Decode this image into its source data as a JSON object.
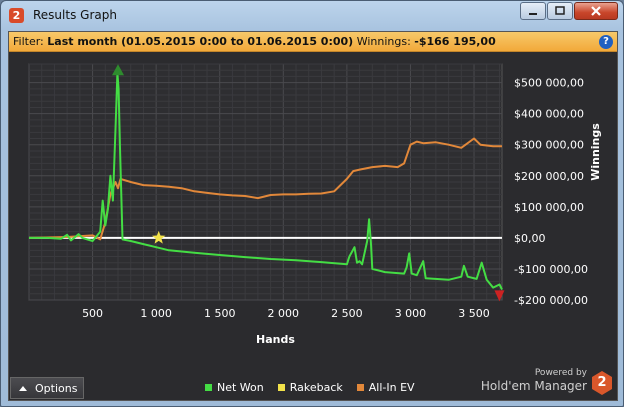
{
  "window": {
    "title": "Results Graph",
    "badge": "2"
  },
  "filter": {
    "label": "Filter:",
    "value": "Last month (01.05.2015 0:00 to 01.06.2015 0:00)",
    "winnings_label": "Winnings:",
    "winnings_value": "-$166 195,00"
  },
  "options": {
    "label": "Options",
    "icon": "caret-up-icon"
  },
  "legend": [
    {
      "label": "Net Won",
      "color": "#44dd44"
    },
    {
      "label": "Rakeback",
      "color": "#f2e24a"
    },
    {
      "label": "All-In EV",
      "color": "#e2883a"
    }
  ],
  "branding": {
    "powered_by": "Powered by",
    "product": "Hold'em Manager",
    "logo_text": "2"
  },
  "chart_data": {
    "type": "line",
    "xlabel": "Hands",
    "ylabel": "Winnings",
    "xlim": [
      0,
      3720
    ],
    "ylim": [
      -200000,
      560000
    ],
    "x_ticks": [
      {
        "v": 500,
        "label": "500"
      },
      {
        "v": 1000,
        "label": "1 000"
      },
      {
        "v": 1500,
        "label": "1 500"
      },
      {
        "v": 2000,
        "label": "2 000"
      },
      {
        "v": 2500,
        "label": "2 500"
      },
      {
        "v": 3000,
        "label": "3 000"
      },
      {
        "v": 3500,
        "label": "3 500"
      }
    ],
    "y_ticks": [
      {
        "v": 500000,
        "label": "$500 000,00"
      },
      {
        "v": 400000,
        "label": "$400 000,00"
      },
      {
        "v": 300000,
        "label": "$300 000,00"
      },
      {
        "v": 200000,
        "label": "$200 000,00"
      },
      {
        "v": 100000,
        "label": "$100 000,00"
      },
      {
        "v": 0,
        "label": "$0,00"
      },
      {
        "v": -100000,
        "label": "-$100 000,00"
      },
      {
        "v": -200000,
        "label": "-$200 000,00"
      }
    ],
    "series": [
      {
        "name": "Net Won",
        "color": "#44dd44",
        "points": [
          [
            0,
            0
          ],
          [
            150,
            0
          ],
          [
            250,
            -3000
          ],
          [
            300,
            10000
          ],
          [
            330,
            -8000
          ],
          [
            390,
            12000
          ],
          [
            420,
            0
          ],
          [
            500,
            -10000
          ],
          [
            560,
            20000
          ],
          [
            580,
            120000
          ],
          [
            600,
            40000
          ],
          [
            620,
            90000
          ],
          [
            640,
            200000
          ],
          [
            660,
            120000
          ],
          [
            680,
            350000
          ],
          [
            695,
            530000
          ],
          [
            705,
            480000
          ],
          [
            715,
            300000
          ],
          [
            725,
            150000
          ],
          [
            735,
            -5000
          ],
          [
            800,
            -10000
          ],
          [
            900,
            -20000
          ],
          [
            1000,
            -30000
          ],
          [
            1100,
            -40000
          ],
          [
            1300,
            -48000
          ],
          [
            1500,
            -55000
          ],
          [
            1700,
            -62000
          ],
          [
            1900,
            -68000
          ],
          [
            2100,
            -72000
          ],
          [
            2300,
            -78000
          ],
          [
            2500,
            -85000
          ],
          [
            2520,
            -60000
          ],
          [
            2560,
            -30000
          ],
          [
            2580,
            -80000
          ],
          [
            2600,
            -75000
          ],
          [
            2620,
            -85000
          ],
          [
            2660,
            -10000
          ],
          [
            2675,
            60000
          ],
          [
            2690,
            -20000
          ],
          [
            2700,
            -100000
          ],
          [
            2800,
            -110000
          ],
          [
            2950,
            -115000
          ],
          [
            2970,
            -95000
          ],
          [
            2990,
            -50000
          ],
          [
            3010,
            -115000
          ],
          [
            3050,
            -120000
          ],
          [
            3100,
            -75000
          ],
          [
            3120,
            -130000
          ],
          [
            3300,
            -135000
          ],
          [
            3400,
            -125000
          ],
          [
            3420,
            -90000
          ],
          [
            3450,
            -125000
          ],
          [
            3520,
            -132000
          ],
          [
            3560,
            -80000
          ],
          [
            3600,
            -135000
          ],
          [
            3650,
            -160000
          ],
          [
            3700,
            -150000
          ],
          [
            3720,
            -166195
          ]
        ]
      },
      {
        "name": "All-In EV",
        "color": "#e2883a",
        "points": [
          [
            0,
            0
          ],
          [
            300,
            3000
          ],
          [
            500,
            8000
          ],
          [
            560,
            -5000
          ],
          [
            600,
            50000
          ],
          [
            640,
            140000
          ],
          [
            680,
            180000
          ],
          [
            700,
            160000
          ],
          [
            720,
            190000
          ],
          [
            800,
            180000
          ],
          [
            900,
            170000
          ],
          [
            1000,
            168000
          ],
          [
            1100,
            165000
          ],
          [
            1200,
            160000
          ],
          [
            1300,
            150000
          ],
          [
            1400,
            145000
          ],
          [
            1500,
            140000
          ],
          [
            1600,
            137000
          ],
          [
            1700,
            135000
          ],
          [
            1800,
            128000
          ],
          [
            1900,
            138000
          ],
          [
            2000,
            140000
          ],
          [
            2100,
            140000
          ],
          [
            2200,
            142000
          ],
          [
            2300,
            143000
          ],
          [
            2400,
            150000
          ],
          [
            2450,
            170000
          ],
          [
            2500,
            190000
          ],
          [
            2550,
            215000
          ],
          [
            2600,
            220000
          ],
          [
            2700,
            228000
          ],
          [
            2800,
            232000
          ],
          [
            2900,
            228000
          ],
          [
            2950,
            240000
          ],
          [
            3000,
            300000
          ],
          [
            3050,
            310000
          ],
          [
            3100,
            305000
          ],
          [
            3200,
            308000
          ],
          [
            3300,
            300000
          ],
          [
            3400,
            290000
          ],
          [
            3500,
            320000
          ],
          [
            3550,
            300000
          ],
          [
            3650,
            295000
          ],
          [
            3720,
            295000
          ]
        ]
      },
      {
        "name": "Rakeback",
        "color": "#f2e24a",
        "points": [
          [
            0,
            0
          ],
          [
            3720,
            0
          ]
        ]
      }
    ],
    "markers": [
      {
        "x": 700,
        "y": 540000,
        "type": "max",
        "color": "#2e8b2e"
      },
      {
        "x": 3700,
        "y": -185000,
        "type": "min",
        "color": "#cc2222"
      },
      {
        "x": 1020,
        "y": 0,
        "type": "star",
        "color": "#f2e24a"
      }
    ]
  }
}
